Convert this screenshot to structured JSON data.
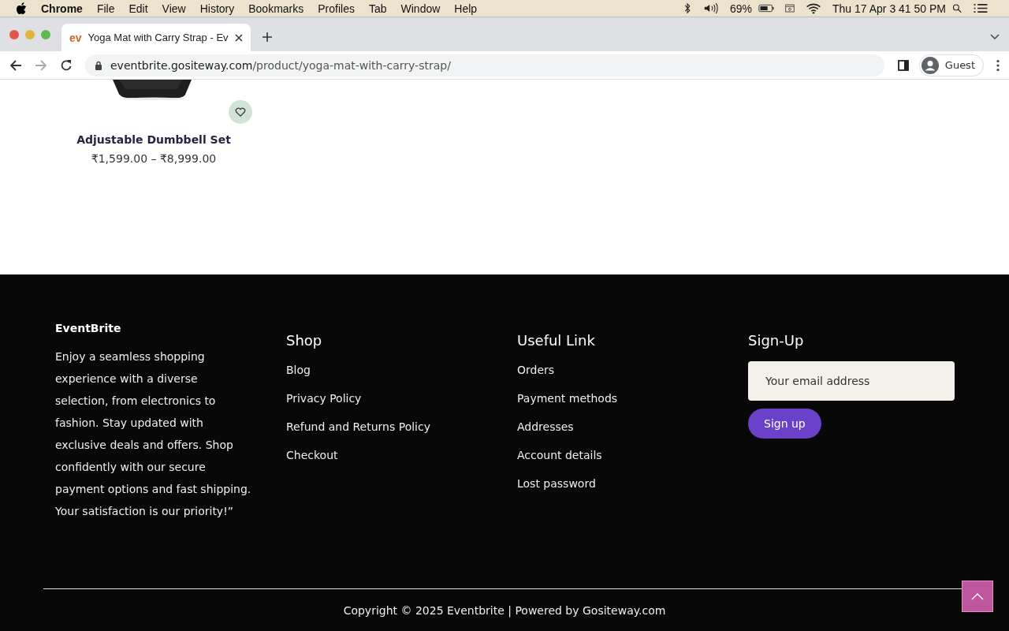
{
  "menu_bar": {
    "app": "Chrome",
    "items": [
      "File",
      "Edit",
      "View",
      "History",
      "Bookmarks",
      "Profiles",
      "Tab",
      "Window",
      "Help"
    ],
    "battery": "69%",
    "clock": "Thu 17 Apr  3 41 50 PM"
  },
  "browser": {
    "tab": {
      "favicon": "ev",
      "title": "Yoga Mat with Carry Strap - Ev"
    },
    "url_host": "eventbrite.gositeway.com",
    "url_path": "/product/yoga-mat-with-carry-strap/",
    "profile": "Guest"
  },
  "product": {
    "kind": "picture",
    "name": "Adjustable Dumbbell Set",
    "price": "₹1,599.00 – ₹8,999.00"
  },
  "footer": {
    "brand": "EventBrite",
    "about": "Enjoy a seamless shopping experience with a diverse selection, from electronics to fashion. Stay updated with exclusive deals and offers. Shop confidently with our secure payment options and fast shipping. Your satisfaction is our priority!”",
    "columns": [
      {
        "title": "Shop",
        "links": [
          "Blog",
          "Privacy Policy",
          "Refund and Returns Policy",
          "Checkout"
        ]
      },
      {
        "title": "Useful Link",
        "links": [
          "Orders",
          "Payment methods",
          "Addresses",
          "Account details",
          "Lost password"
        ]
      }
    ],
    "signup": {
      "title": "Sign-Up",
      "placeholder": "Your email address",
      "button": "Sign up"
    },
    "copyright": "Copyright © 2025 Eventbrite | Powered by Gositeway.com"
  }
}
